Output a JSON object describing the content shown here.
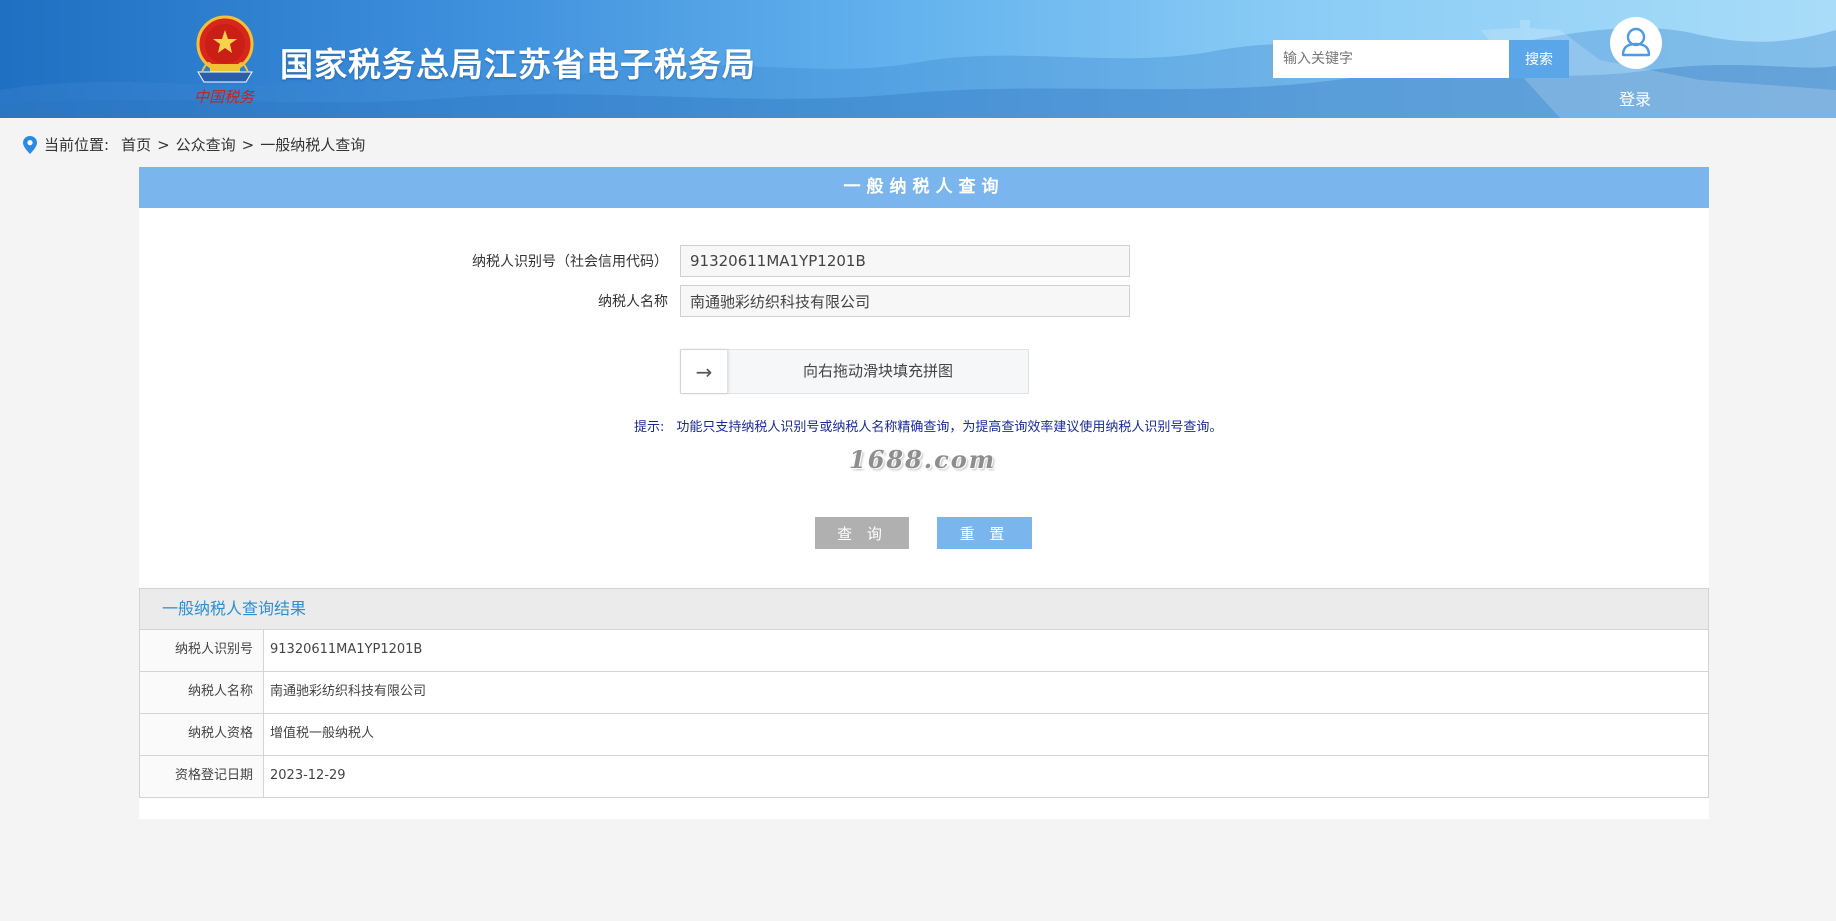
{
  "header": {
    "emblem_caption": "中国税务",
    "site_title": "国家税务总局江苏省电子税务局",
    "search_placeholder": "输入关键字",
    "search_button": "搜索",
    "login_label": "登录"
  },
  "breadcrumb": {
    "prefix": "当前位置:",
    "items": [
      "首页",
      "公众查询",
      "一般纳税人查询"
    ],
    "separator": ">"
  },
  "query_form": {
    "title": "一般纳税人查询",
    "taxpayer_id_label": "纳税人识别号（社会信用代码）",
    "taxpayer_id_value": "91320611MA1YP1201B",
    "taxpayer_name_label": "纳税人名称",
    "taxpayer_name_value": "南通驰彩纺织科技有限公司",
    "slider_text": "向右拖动滑块填充拼图",
    "slider_arrow": "→",
    "tip_label": "提示:",
    "tip_text": "功能只支持纳税人识别号或纳税人名称精确查询，为提高查询效率建议使用纳税人识别号查询。",
    "watermark": "1688.com",
    "query_button": "查 询",
    "reset_button": "重 置"
  },
  "results": {
    "title": "一般纳税人查询结果",
    "rows": [
      {
        "label": "纳税人识别号",
        "value": "91320611MA1YP1201B"
      },
      {
        "label": "纳税人名称",
        "value": "南通驰彩纺织科技有限公司"
      },
      {
        "label": "纳税人资格",
        "value": "增值税一般纳税人"
      },
      {
        "label": "资格登记日期",
        "value": "2023-12-29"
      }
    ]
  },
  "colors": {
    "header_blue": "#1f6fc2",
    "panel_title_bg": "#7ab5ee",
    "results_title": "#2d8fd0",
    "tip_text": "#1a2a99"
  }
}
